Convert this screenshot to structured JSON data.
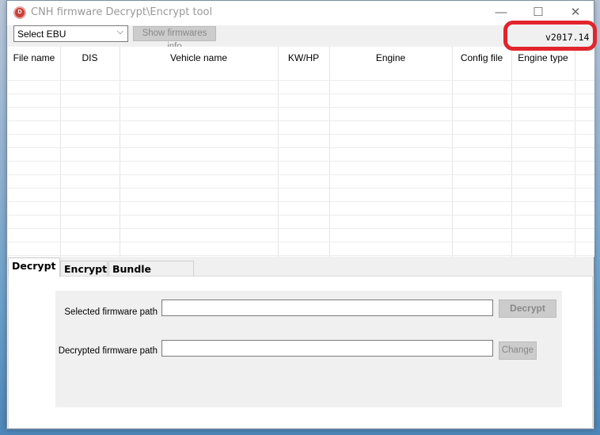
{
  "window": {
    "title": "CNH firmware Decrypt\\Encrypt tool",
    "icon": "app-logo-icon",
    "controls": [
      "minimize-icon",
      "maximize-icon",
      "close-icon"
    ]
  },
  "toolbar": {
    "ebu_select": "Select EBU",
    "show_info_label": "Show firmwares info",
    "version": "v2017.14",
    "highlight_color": "#e2242c"
  },
  "table": {
    "columns": [
      "File name",
      "DIS",
      "Vehicle name",
      "KW/HP",
      "Engine",
      "Config file",
      "Engine type"
    ],
    "rows": []
  },
  "tabs": [
    {
      "label": "Decrypt",
      "active": true
    },
    {
      "label": "Encrypt",
      "active": false
    },
    {
      "label": "Bundle Decrypt",
      "active": false
    }
  ],
  "decrypt": {
    "selected_label": "Selected firmware path",
    "selected_value": "",
    "decrypt_button": "Decrypt",
    "decrypted_label": "Decrypted firmware path",
    "decrypted_value": "",
    "change_button": "Change"
  }
}
